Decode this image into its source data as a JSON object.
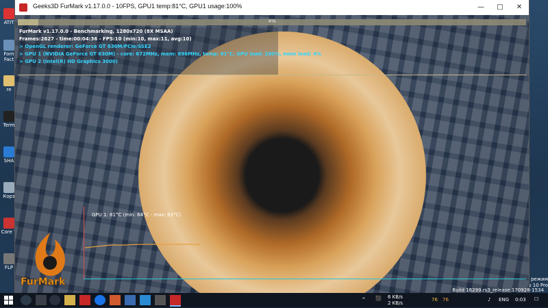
{
  "window": {
    "title": "Geeks3D FurMark v1.17.0.0 - 10FPS, GPU1 temp:81°C, GPU1 usage:100%",
    "minimize": "—",
    "maximize": "□",
    "close": "✕"
  },
  "benchmark": {
    "progress_text": "4%",
    "progress": 0.04,
    "lines": [
      "FurMark v1.17.0.0 - Benchmarking, 1280x720 (8X MSAA)",
      "Frames:2627 - time:00:04:36 - FPS:10 (min:10, max:11, avg:10)",
      "> OpenGL renderer: GeForce GT 630M/PCIe/SSE2",
      "> GPU 1 (NVIDIA GeForce GT 630M) - core: 672MHz, mem: 896MHz, temp: 81°C, GPU load: 100%, mem load: 4%",
      "> GPU 2 (Intel(R) HD Graphics 3000)"
    ],
    "graph_label": "GPU 1: 81°C (min: 64°C - max: 83°C)",
    "logo_text": "FurMark"
  },
  "desktop": {
    "icons": [
      "ATIT",
      "Forn Fact",
      "re",
      "Term",
      "SHA",
      "Корз",
      "Core T",
      "FLP"
    ],
    "right_lines": [
      "й режим",
      "s 10 Pro"
    ],
    "build": "Build 16299.rs3_release.170928-1534"
  },
  "taskbar": {
    "net_up": "6 KB/s",
    "net_down": "2 KB/s",
    "temp1": "76",
    "temp2": "76",
    "lang": "ENG",
    "time": "0:03"
  },
  "colors": {
    "info_white": "#ffffff",
    "info_cyan": "#35d6ff",
    "progress": "#c4b98a",
    "graph_line": "#e8a040",
    "axis_v": "#e05050",
    "axis_h": "#29c6d4"
  }
}
